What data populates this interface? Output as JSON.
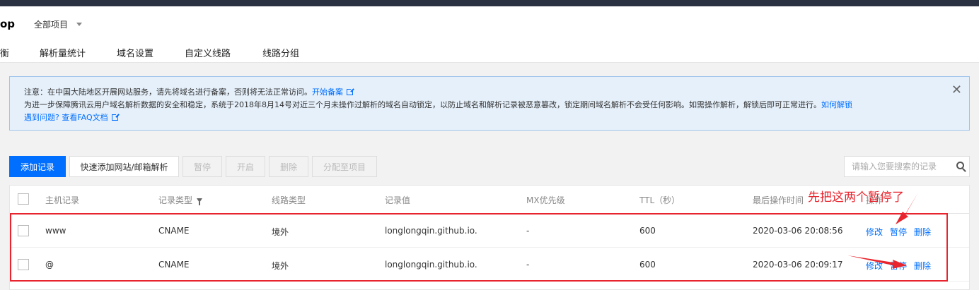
{
  "header": {
    "app_title": "op",
    "project_select": "全部项目",
    "tabs": [
      {
        "label": "衡"
      },
      {
        "label": "解析量统计"
      },
      {
        "label": "域名设置"
      },
      {
        "label": "自定义线路"
      },
      {
        "label": "线路分组"
      }
    ]
  },
  "notice": {
    "line1_text": "注意：在中国大陆地区开展网站服务，请先将域名进行备案，否则将无法正常访问。",
    "line1_link": "开始备案",
    "line2_text": "为进一步保障腾讯云用户域名解析数据的安全和稳定，系统于2018年8月14号对近三个月未操作过解析的域名自动锁定，以防止域名和解析记录被恶意篡改，锁定期间域名解析不会受任何影响。如需操作解析，解锁后即可正常进行。",
    "line2_link": "如何解锁",
    "line3_link_a": "遇到问题?",
    "line3_link_b": "查看FAQ文档",
    "close_symbol": "✕"
  },
  "toolbar": {
    "add": "添加记录",
    "quick_add": "快速添加网站/邮箱解析",
    "pause": "暂停",
    "enable": "开启",
    "delete": "删除",
    "assign": "分配至项目",
    "search_placeholder": "请输入您要搜索的记录"
  },
  "table": {
    "columns": [
      "主机记录",
      "记录类型",
      "线路类型",
      "记录值",
      "MX优先级",
      "TTL（秒）",
      "最后操作时间",
      "操作"
    ],
    "rows": [
      {
        "host": "www",
        "type": "CNAME",
        "line": "境外",
        "value": "longlongqin.github.io.",
        "mx": "-",
        "ttl": "600",
        "time": "2020-03-06 20:08:56",
        "edit": "修改",
        "pause": "暂停",
        "delete": "删除"
      },
      {
        "host": "@",
        "type": "CNAME",
        "line": "境外",
        "value": "longlongqin.github.io.",
        "mx": "-",
        "ttl": "600",
        "time": "2020-03-06 20:09:17",
        "edit": "修改",
        "pause": "暂停",
        "delete": "删除"
      }
    ]
  },
  "annotation": {
    "text": "先把这两个暂停了",
    "color": "#e8252e"
  },
  "colors": {
    "accent": "#006eff",
    "topbar": "#2a3140",
    "notice_bg": "#e5f0fb"
  }
}
